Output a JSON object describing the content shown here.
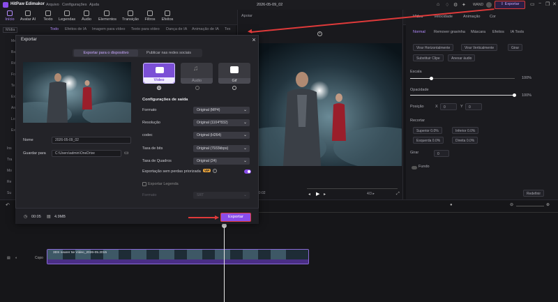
{
  "app": {
    "title": "HitPaw Edimakor",
    "menu": [
      "Arquivo",
      "Configurações",
      "Ajuda"
    ],
    "project_title": "2026-05-09_02",
    "badge": "WAND"
  },
  "toolbar": {
    "items": [
      "Início",
      "Avatar AI",
      "Texto",
      "Legendas",
      "Áudio",
      "Elementos",
      "Transição",
      "Filtros",
      "Efeitos"
    ]
  },
  "export_top": "Exportar",
  "media": {
    "tabs": [
      "Mídia",
      "Todo",
      "Efeitos de IA",
      "Imagem para vídeo",
      "Texto para vídeo",
      "Dança de IA",
      "Animação de IA",
      "Tex"
    ],
    "nav": [
      "Me",
      "Ba",
      "Ré",
      "Fo",
      "Te",
      "Ex",
      "An",
      "Lo",
      "Ex",
      "Ins",
      "Tra",
      "Mo",
      "Re",
      "Su"
    ]
  },
  "preview": {
    "label": "Apoiar",
    "time": "4/3 ▸",
    "time_left": "00:02"
  },
  "rightpanel": {
    "tabs": [
      "Vídeo",
      "Velocidade",
      "Animação",
      "Cor"
    ],
    "subtabs": [
      "Normal",
      "Remover gravinha",
      "Máscara",
      "Efeitos",
      "IA Tools"
    ],
    "buttons": [
      "Virar Horizontalmente",
      "Virar Verticalmente",
      "Girar",
      "Substituir Clipe",
      "Anexar áudio"
    ],
    "escala_label": "Escala",
    "escala_value": "100%",
    "opacidade_label": "Opacidade",
    "opacidade_value": "100%",
    "posicao_label": "Posição",
    "pos_x_label": "X",
    "pos_x": "0",
    "pos_y_label": "Y",
    "pos_y": "0",
    "recortar_label": "Recortar",
    "crop": [
      "Superior 0.0%",
      "Inferior 0.0%",
      "Esquerda 0.0%",
      "Direita 0.0%"
    ],
    "girar_label": "Girar",
    "girar_value": "0",
    "fundo_label": "Fundo",
    "redefinir": "Redefinir"
  },
  "timeline": {
    "track_label": "Copo",
    "clip_name": "3DS nearer 5e Video_2026-05.2015"
  },
  "dialog": {
    "title": "Exportar",
    "segment": [
      "Exportar para o dispositivo",
      "Publicar nas redes sociais"
    ],
    "formats": [
      {
        "label": "Vídeo",
        "icon": "video-icon"
      },
      {
        "label": "Áudio",
        "icon": "music-icon"
      },
      {
        "label": "Gif",
        "icon": "gif-icon"
      }
    ],
    "section_title": "Configurações de saída",
    "settings": [
      {
        "label": "Formato",
        "value": "Original (MP4)"
      },
      {
        "label": "Resolução",
        "value": "Original (1104*832)"
      },
      {
        "label": "codec",
        "value": "Original (H264)"
      },
      {
        "label": "Taxa de bits",
        "value": "Original (7933kbps)"
      },
      {
        "label": "Taxa de Quadros",
        "value": "Original (24)"
      }
    ],
    "lossless_label": "Exportação sem perdas priorizada",
    "vip": "VIP",
    "subtitle_check": "Exportar Legenda",
    "subtitle_format_label": "Formato",
    "subtitle_format_value": "SRT",
    "name_label": "Nome",
    "name_value": "2026-05-09_02",
    "save_label": "Guardar para",
    "save_value": "C:\\Users\\admin\\OneDrive",
    "duration": "00:05",
    "size": "4.9MB",
    "export_button": "Exportar"
  },
  "colors": {
    "accent": "#8a4dea",
    "highlight": "#e03a3a",
    "bg": "#151518"
  }
}
